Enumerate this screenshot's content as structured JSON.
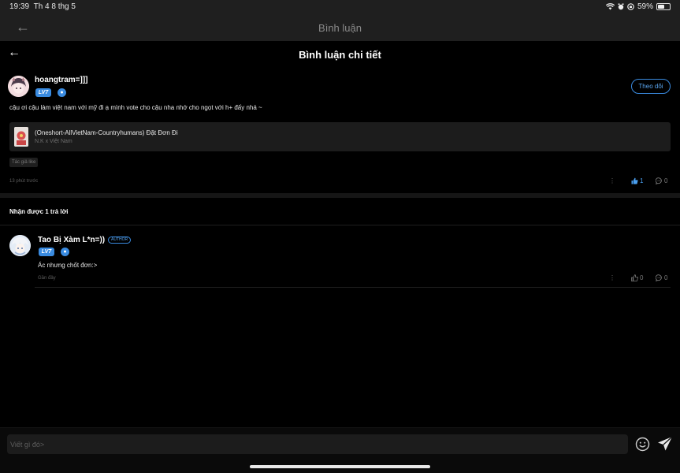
{
  "status_bar": {
    "time": "19:39",
    "date": "Th 4 8 thg 5",
    "battery": "59%",
    "battery_level": 0.59,
    "icons": [
      "wifi-icon",
      "alarm-icon",
      "screen-lock-icon",
      "battery-icon"
    ]
  },
  "back_header": {
    "title": "Bình luận"
  },
  "sheet": {
    "title": "Bình luận chi tiết"
  },
  "comment": {
    "username": "hoangtram=]]]",
    "level": "LV7",
    "follow_label": "Theo dõi",
    "text": "cậu ơi cậu làm việt nam với mỹ đi ạ mình vote cho cậu nha nhớ cho ngọt với h+ đấy nhá ~",
    "story": {
      "title": "(Oneshort-AllVietNam-Countryhumans) Đặt Đơn Đi",
      "subtitle": "N.K x Việt Nam"
    },
    "author_like": "Tác giả like",
    "time": "13 phút trước",
    "likes": "1",
    "replies": "0"
  },
  "replies_section": {
    "title": "Nhận được 1 trả lời"
  },
  "reply": {
    "username": "Tao Bị Xàm L*n=))",
    "author_tag": "AUTHOR",
    "level": "LV7",
    "text": "Ác nhưng chốt đơn:>",
    "time": "Gần đây",
    "likes": "0",
    "replies": "0"
  },
  "input": {
    "placeholder": "Viết gì đó>"
  },
  "colors": {
    "accent": "#3a8be0",
    "like_active": "#4a9ff0",
    "background": "#000000"
  }
}
